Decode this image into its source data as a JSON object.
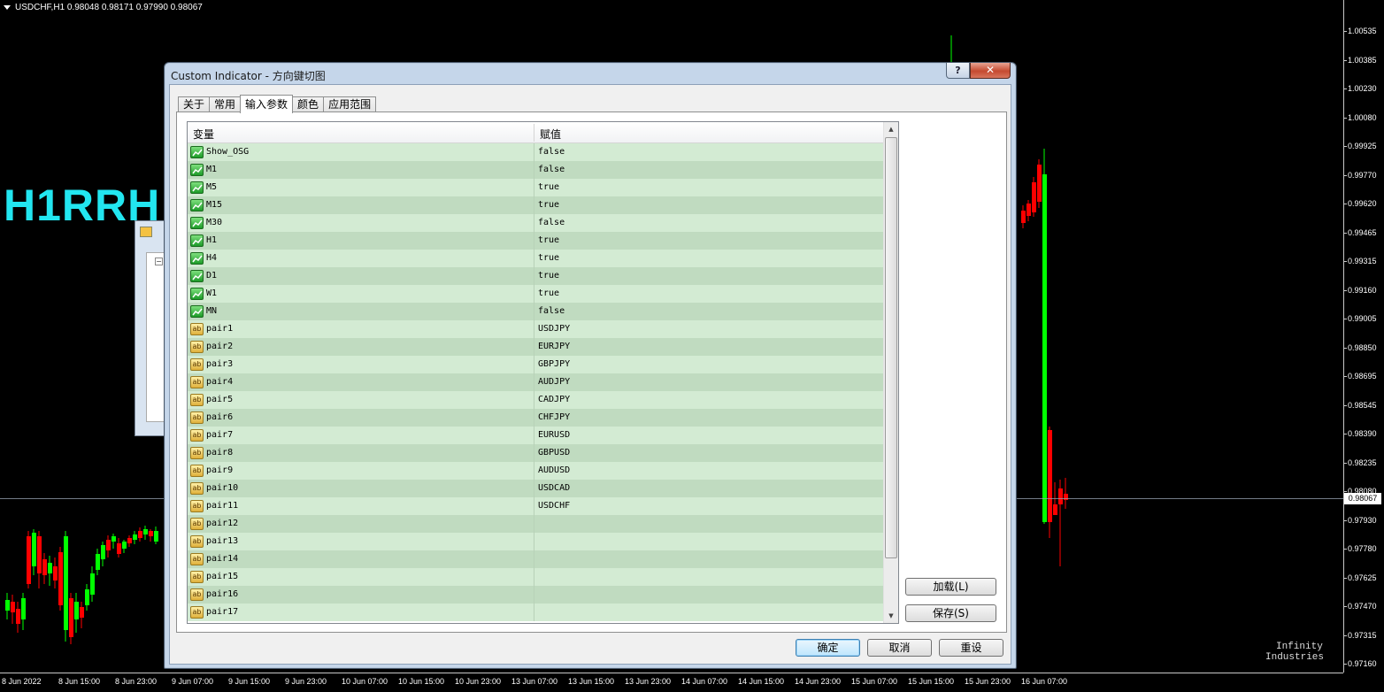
{
  "chart": {
    "header": "USDCHF,H1  0.98048 0.98171 0.97990 0.98067",
    "indicator_label": "H1RRH",
    "watermark_line1": "Infinity",
    "watermark_line2": "Industries",
    "current_price": "0.98067",
    "price_labels": [
      "1.00535",
      "1.00385",
      "1.00230",
      "1.00080",
      "0.99925",
      "0.99770",
      "0.99620",
      "0.99465",
      "0.99315",
      "0.99160",
      "0.99005",
      "0.98850",
      "0.98695",
      "0.98545",
      "0.98390",
      "0.98235",
      "0.98080",
      "0.97930",
      "0.97780",
      "0.97625",
      "0.97470",
      "0.97315",
      "0.97160"
    ],
    "time_labels": [
      "8 Jun 2022",
      "8 Jun 15:00",
      "8 Jun 23:00",
      "9 Jun 07:00",
      "9 Jun 15:00",
      "9 Jun 23:00",
      "10 Jun 07:00",
      "10 Jun 15:00",
      "10 Jun 23:00",
      "13 Jun 07:00",
      "13 Jun 15:00",
      "13 Jun 23:00",
      "14 Jun 07:00",
      "14 Jun 15:00",
      "14 Jun 23:00",
      "15 Jun 07:00",
      "15 Jun 15:00",
      "15 Jun 23:00",
      "16 Jun 07:00"
    ],
    "colors": {
      "bull": "#00ff00",
      "bear": "#ff0000",
      "label": "#22e6f0"
    }
  },
  "dialog": {
    "title": "Custom Indicator - 方向键切图",
    "help_btn": "?",
    "close_btn": "✕",
    "tabs": [
      "关于",
      "常用",
      "输入参数",
      "颜色",
      "应用范围"
    ],
    "active_tab": 2,
    "grid": {
      "col_variable": "变量",
      "col_value": "赋值",
      "rows": [
        {
          "icon": "number-param-icon",
          "name": "Show_OSG",
          "value": "false"
        },
        {
          "icon": "number-param-icon",
          "name": "M1",
          "value": "false"
        },
        {
          "icon": "number-param-icon",
          "name": "M5",
          "value": "true"
        },
        {
          "icon": "number-param-icon",
          "name": "M15",
          "value": "true"
        },
        {
          "icon": "number-param-icon",
          "name": "M30",
          "value": "false"
        },
        {
          "icon": "number-param-icon",
          "name": "H1",
          "value": "true"
        },
        {
          "icon": "number-param-icon",
          "name": "H4",
          "value": "true"
        },
        {
          "icon": "number-param-icon",
          "name": "D1",
          "value": "true"
        },
        {
          "icon": "number-param-icon",
          "name": "W1",
          "value": "true"
        },
        {
          "icon": "number-param-icon",
          "name": "MN",
          "value": "false"
        },
        {
          "icon": "string-param-icon",
          "name": "pair1",
          "value": "USDJPY"
        },
        {
          "icon": "string-param-icon",
          "name": "pair2",
          "value": "EURJPY"
        },
        {
          "icon": "string-param-icon",
          "name": "pair3",
          "value": "GBPJPY"
        },
        {
          "icon": "string-param-icon",
          "name": "pair4",
          "value": "AUDJPY"
        },
        {
          "icon": "string-param-icon",
          "name": "pair5",
          "value": "CADJPY"
        },
        {
          "icon": "string-param-icon",
          "name": "pair6",
          "value": "CHFJPY"
        },
        {
          "icon": "string-param-icon",
          "name": "pair7",
          "value": "EURUSD"
        },
        {
          "icon": "string-param-icon",
          "name": "pair8",
          "value": "GBPUSD"
        },
        {
          "icon": "string-param-icon",
          "name": "pair9",
          "value": "AUDUSD"
        },
        {
          "icon": "string-param-icon",
          "name": "pair10",
          "value": "USDCAD"
        },
        {
          "icon": "string-param-icon",
          "name": "pair11",
          "value": "USDCHF"
        },
        {
          "icon": "string-param-icon",
          "name": "pair12",
          "value": ""
        },
        {
          "icon": "string-param-icon",
          "name": "pair13",
          "value": ""
        },
        {
          "icon": "string-param-icon",
          "name": "pair14",
          "value": ""
        },
        {
          "icon": "string-param-icon",
          "name": "pair15",
          "value": ""
        },
        {
          "icon": "string-param-icon",
          "name": "pair16",
          "value": ""
        },
        {
          "icon": "string-param-icon",
          "name": "pair17",
          "value": ""
        }
      ]
    },
    "load_btn": "加载(L)",
    "save_btn": "保存(S)",
    "ok_btn": "确定",
    "cancel_btn": "取消",
    "reset_btn": "重设"
  }
}
